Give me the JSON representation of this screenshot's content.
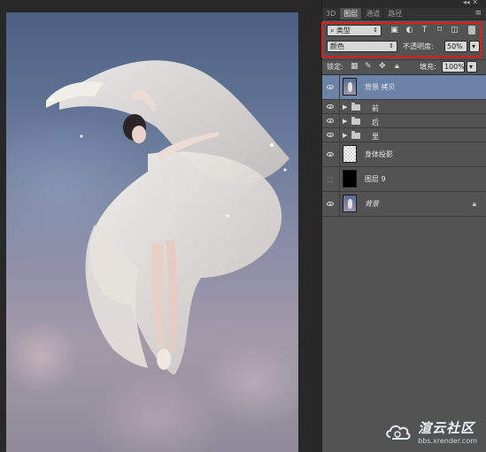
{
  "canvas": {
    "image_label": "photo-dancer"
  },
  "panel": {
    "tabs": [
      {
        "label": "3D"
      },
      {
        "label": "图层",
        "active": true
      },
      {
        "label": "通道"
      },
      {
        "label": "路径"
      }
    ],
    "filter_select": "类型",
    "blend_mode": "颜色",
    "opacity_label": "不透明度:",
    "opacity_value": "50%",
    "lock_label": "锁定:",
    "fill_label": "填充:",
    "fill_value": "100%",
    "layers": [
      {
        "name": "背景 拷贝",
        "type": "photo",
        "visible": true,
        "selected": true
      },
      {
        "name": "前",
        "type": "group",
        "visible": true
      },
      {
        "name": "后",
        "type": "group",
        "visible": true
      },
      {
        "name": "里",
        "type": "group",
        "visible": true
      },
      {
        "name": "身体投影",
        "type": "transparent",
        "visible": true
      },
      {
        "name": "图层 9",
        "type": "black",
        "visible": false
      },
      {
        "name": "背景",
        "type": "photo",
        "visible": true,
        "locked": true,
        "italic": true
      }
    ]
  },
  "watermark": {
    "name": "渲云社区",
    "url": "bbs.xrender.com"
  },
  "colors": {
    "highlight": "#e41b1b",
    "selected_layer": "#6c82a6",
    "panel_bg": "#535353"
  }
}
